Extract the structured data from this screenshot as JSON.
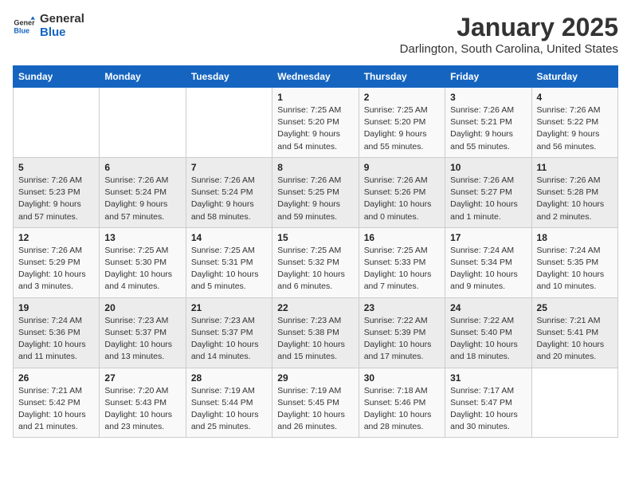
{
  "header": {
    "logo_line1": "General",
    "logo_line2": "Blue",
    "month": "January 2025",
    "location": "Darlington, South Carolina, United States"
  },
  "days_of_week": [
    "Sunday",
    "Monday",
    "Tuesday",
    "Wednesday",
    "Thursday",
    "Friday",
    "Saturday"
  ],
  "weeks": [
    [
      {
        "day": "",
        "info": ""
      },
      {
        "day": "",
        "info": ""
      },
      {
        "day": "",
        "info": ""
      },
      {
        "day": "1",
        "info": "Sunrise: 7:25 AM\nSunset: 5:20 PM\nDaylight: 9 hours\nand 54 minutes."
      },
      {
        "day": "2",
        "info": "Sunrise: 7:25 AM\nSunset: 5:20 PM\nDaylight: 9 hours\nand 55 minutes."
      },
      {
        "day": "3",
        "info": "Sunrise: 7:26 AM\nSunset: 5:21 PM\nDaylight: 9 hours\nand 55 minutes."
      },
      {
        "day": "4",
        "info": "Sunrise: 7:26 AM\nSunset: 5:22 PM\nDaylight: 9 hours\nand 56 minutes."
      }
    ],
    [
      {
        "day": "5",
        "info": "Sunrise: 7:26 AM\nSunset: 5:23 PM\nDaylight: 9 hours\nand 57 minutes."
      },
      {
        "day": "6",
        "info": "Sunrise: 7:26 AM\nSunset: 5:24 PM\nDaylight: 9 hours\nand 57 minutes."
      },
      {
        "day": "7",
        "info": "Sunrise: 7:26 AM\nSunset: 5:24 PM\nDaylight: 9 hours\nand 58 minutes."
      },
      {
        "day": "8",
        "info": "Sunrise: 7:26 AM\nSunset: 5:25 PM\nDaylight: 9 hours\nand 59 minutes."
      },
      {
        "day": "9",
        "info": "Sunrise: 7:26 AM\nSunset: 5:26 PM\nDaylight: 10 hours\nand 0 minutes."
      },
      {
        "day": "10",
        "info": "Sunrise: 7:26 AM\nSunset: 5:27 PM\nDaylight: 10 hours\nand 1 minute."
      },
      {
        "day": "11",
        "info": "Sunrise: 7:26 AM\nSunset: 5:28 PM\nDaylight: 10 hours\nand 2 minutes."
      }
    ],
    [
      {
        "day": "12",
        "info": "Sunrise: 7:26 AM\nSunset: 5:29 PM\nDaylight: 10 hours\nand 3 minutes."
      },
      {
        "day": "13",
        "info": "Sunrise: 7:25 AM\nSunset: 5:30 PM\nDaylight: 10 hours\nand 4 minutes."
      },
      {
        "day": "14",
        "info": "Sunrise: 7:25 AM\nSunset: 5:31 PM\nDaylight: 10 hours\nand 5 minutes."
      },
      {
        "day": "15",
        "info": "Sunrise: 7:25 AM\nSunset: 5:32 PM\nDaylight: 10 hours\nand 6 minutes."
      },
      {
        "day": "16",
        "info": "Sunrise: 7:25 AM\nSunset: 5:33 PM\nDaylight: 10 hours\nand 7 minutes."
      },
      {
        "day": "17",
        "info": "Sunrise: 7:24 AM\nSunset: 5:34 PM\nDaylight: 10 hours\nand 9 minutes."
      },
      {
        "day": "18",
        "info": "Sunrise: 7:24 AM\nSunset: 5:35 PM\nDaylight: 10 hours\nand 10 minutes."
      }
    ],
    [
      {
        "day": "19",
        "info": "Sunrise: 7:24 AM\nSunset: 5:36 PM\nDaylight: 10 hours\nand 11 minutes."
      },
      {
        "day": "20",
        "info": "Sunrise: 7:23 AM\nSunset: 5:37 PM\nDaylight: 10 hours\nand 13 minutes."
      },
      {
        "day": "21",
        "info": "Sunrise: 7:23 AM\nSunset: 5:37 PM\nDaylight: 10 hours\nand 14 minutes."
      },
      {
        "day": "22",
        "info": "Sunrise: 7:23 AM\nSunset: 5:38 PM\nDaylight: 10 hours\nand 15 minutes."
      },
      {
        "day": "23",
        "info": "Sunrise: 7:22 AM\nSunset: 5:39 PM\nDaylight: 10 hours\nand 17 minutes."
      },
      {
        "day": "24",
        "info": "Sunrise: 7:22 AM\nSunset: 5:40 PM\nDaylight: 10 hours\nand 18 minutes."
      },
      {
        "day": "25",
        "info": "Sunrise: 7:21 AM\nSunset: 5:41 PM\nDaylight: 10 hours\nand 20 minutes."
      }
    ],
    [
      {
        "day": "26",
        "info": "Sunrise: 7:21 AM\nSunset: 5:42 PM\nDaylight: 10 hours\nand 21 minutes."
      },
      {
        "day": "27",
        "info": "Sunrise: 7:20 AM\nSunset: 5:43 PM\nDaylight: 10 hours\nand 23 minutes."
      },
      {
        "day": "28",
        "info": "Sunrise: 7:19 AM\nSunset: 5:44 PM\nDaylight: 10 hours\nand 25 minutes."
      },
      {
        "day": "29",
        "info": "Sunrise: 7:19 AM\nSunset: 5:45 PM\nDaylight: 10 hours\nand 26 minutes."
      },
      {
        "day": "30",
        "info": "Sunrise: 7:18 AM\nSunset: 5:46 PM\nDaylight: 10 hours\nand 28 minutes."
      },
      {
        "day": "31",
        "info": "Sunrise: 7:17 AM\nSunset: 5:47 PM\nDaylight: 10 hours\nand 30 minutes."
      },
      {
        "day": "",
        "info": ""
      }
    ]
  ]
}
